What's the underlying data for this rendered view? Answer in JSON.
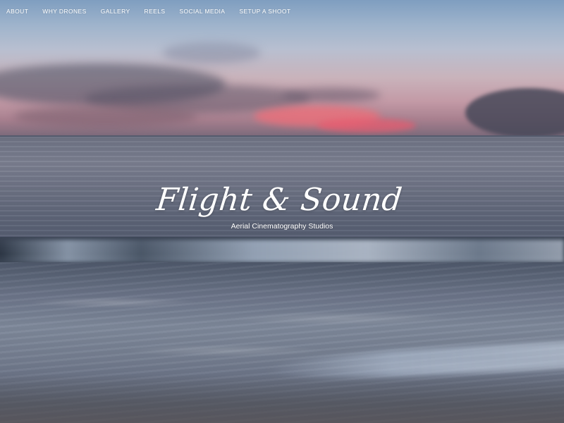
{
  "nav": {
    "items": [
      {
        "label": "ABOUT"
      },
      {
        "label": "WHY DRONES"
      },
      {
        "label": "GALLERY"
      },
      {
        "label": "REELS"
      },
      {
        "label": "SOCIAL MEDIA"
      },
      {
        "label": "SETUP A SHOOT"
      }
    ]
  },
  "hero": {
    "title": "Flight & Sound",
    "subtitle": "Aerial Cinematography Studios"
  }
}
